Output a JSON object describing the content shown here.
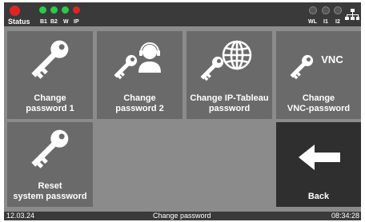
{
  "topbar": {
    "status_label": "Status",
    "indicators": [
      {
        "label": "B1",
        "color": "#2ec94a"
      },
      {
        "label": "B2",
        "color": "#2ec94a"
      },
      {
        "label": "W",
        "color": "#2ec94a"
      },
      {
        "label": "IP",
        "color": "#e02424"
      }
    ],
    "status_color": "#e02424",
    "right_indicators": [
      {
        "label": "WL",
        "color": "#6a6a6a"
      },
      {
        "label": "I1",
        "color": "#6a6a6a"
      },
      {
        "label": "I2",
        "color": "#6a6a6a"
      }
    ],
    "network_icon": "network-icon"
  },
  "tiles": {
    "change_password_1": "Change\npassword 1",
    "change_password_2": "Change\npassword 2",
    "change_ip_tableau": "Change IP-Tableau\npassword",
    "change_vnc": "Change\nVNC-password",
    "vnc_tag": "VNC",
    "reset_system": "Reset\nsystem password",
    "back": "Back"
  },
  "bottombar": {
    "date": "12.03.24",
    "title": "Change password",
    "time": "08:34:28"
  },
  "colors": {
    "background": "#8b8b8b",
    "tile": "#6a6a6a",
    "back_tile": "#2f2f2f",
    "bar": "#3a3a3a"
  }
}
